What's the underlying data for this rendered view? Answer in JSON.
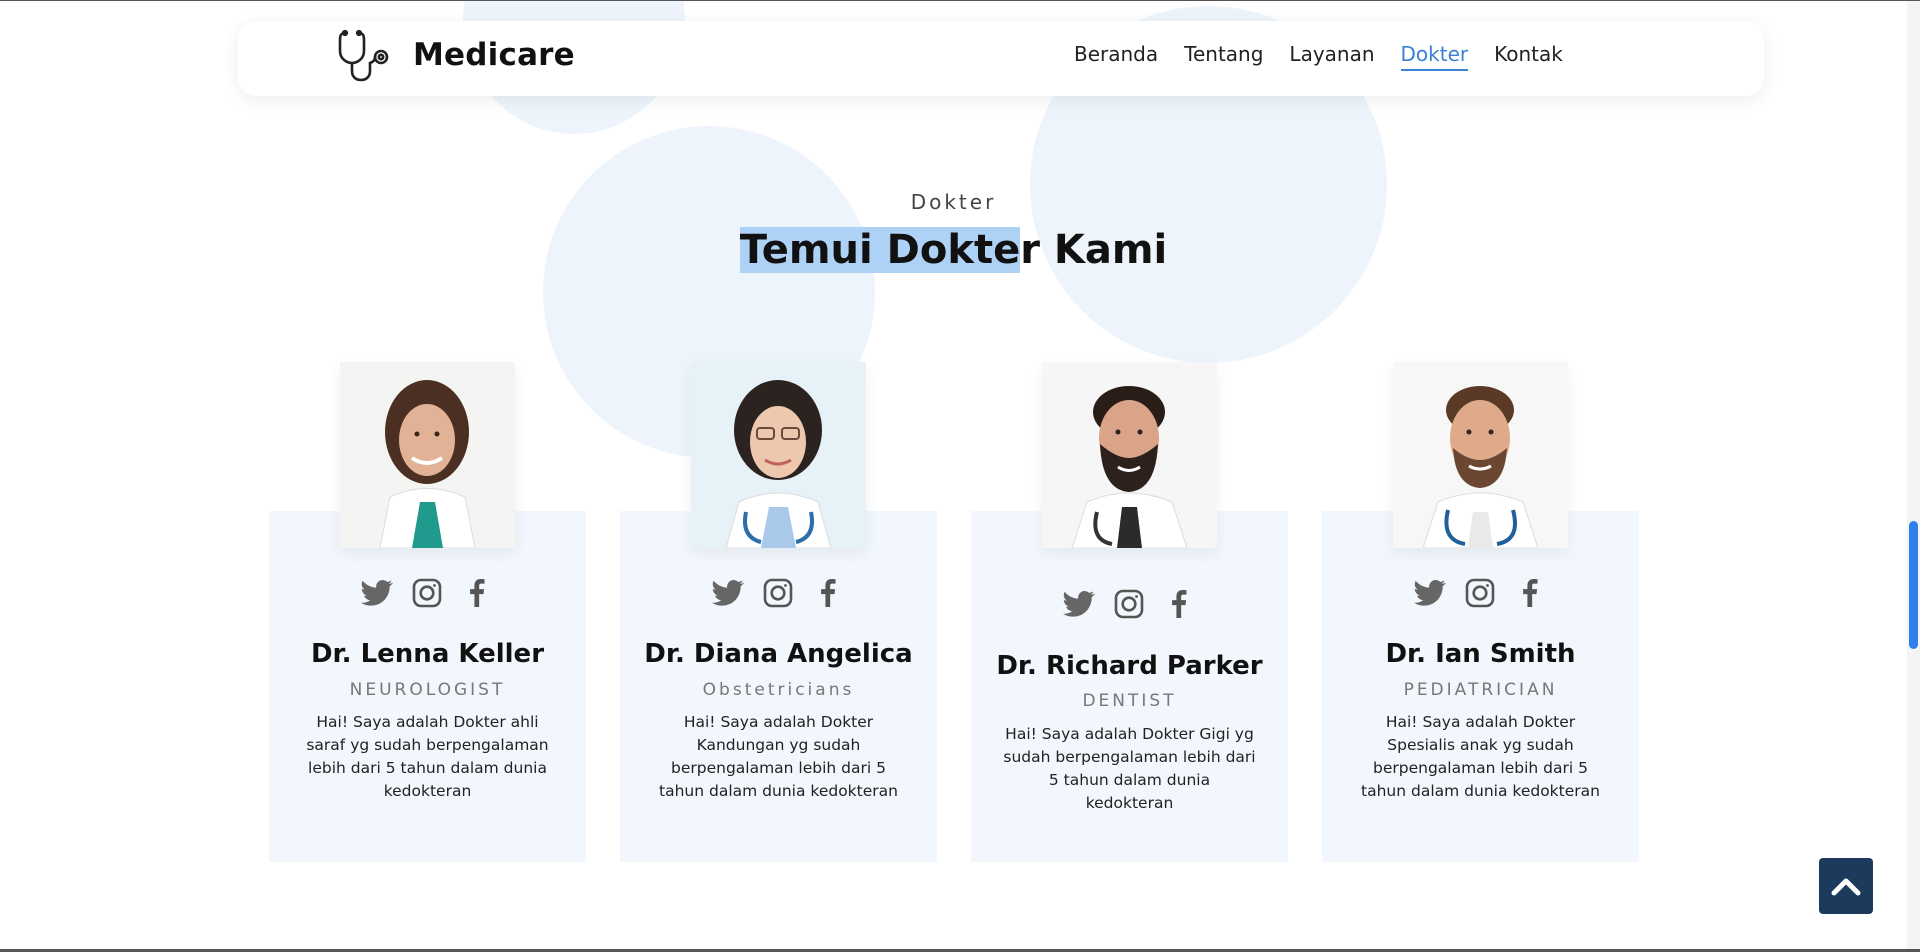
{
  "header": {
    "brand": "Medicare",
    "nav": [
      "Beranda",
      "Tentang",
      "Layanan",
      "Dokter",
      "Kontak"
    ],
    "active_nav": "Dokter"
  },
  "section": {
    "label": "Dokter",
    "title_selected": "Temui Dokte",
    "title_rest": "r Kami"
  },
  "doctors": [
    {
      "name": "Dr. Lenna Keller",
      "role": "NEUROLOGIST",
      "desc": "Hai! Saya adalah Dokter ahli saraf yg sudah berpengalaman lebih dari 5 tahun dalam dunia kedokteran"
    },
    {
      "name": "Dr. Diana Angelica",
      "role": "Obstetricians",
      "desc": "Hai! Saya adalah Dokter Kandungan yg sudah berpengalaman lebih dari 5 tahun dalam dunia kedokteran"
    },
    {
      "name": "Dr. Richard Parker",
      "role": "DENTIST",
      "desc": "Hai! Saya adalah Dokter Gigi yg sudah berpengalaman lebih dari 5 tahun dalam dunia kedokteran"
    },
    {
      "name": "Dr. Ian Smith",
      "role": "PEDIATRICIAN",
      "desc": "Hai! Saya adalah Dokter Spesialis anak yg sudah berpengalaman lebih dari 5 tahun dalam dunia kedokteran"
    }
  ],
  "icons": {
    "logo": "stethoscope-icon",
    "social": [
      "twitter-icon",
      "instagram-icon",
      "facebook-icon"
    ],
    "scroll_top": "chevron-up-icon"
  },
  "colors": {
    "accent": "#3b82d6",
    "card_bg": "#f2f7fe",
    "scroll_top_bg": "#1c3a5c",
    "selection": "#aed1f6"
  }
}
